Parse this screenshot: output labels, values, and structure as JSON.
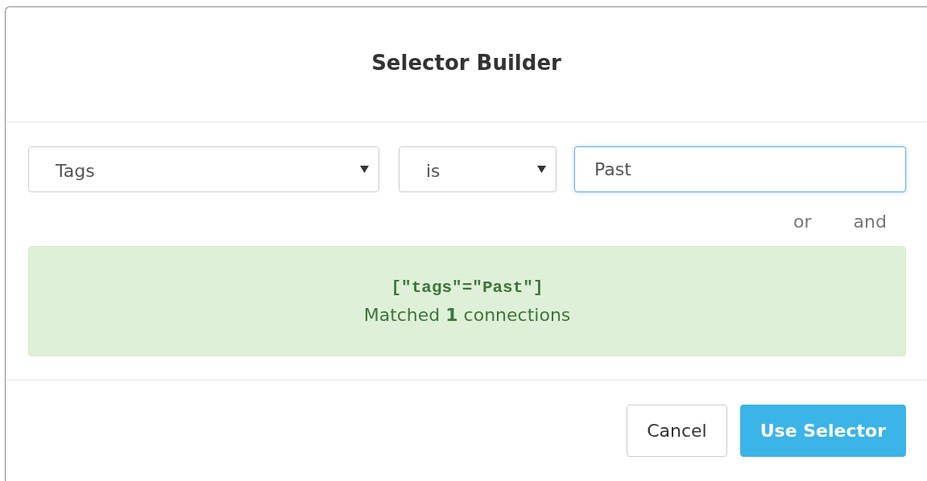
{
  "dialog": {
    "title": "Selector Builder",
    "selects": [
      {
        "value": "Tags"
      },
      {
        "value": "is"
      }
    ],
    "value_field": {
      "value": "Past",
      "focused": true
    },
    "combinators": [
      "or",
      "and"
    ],
    "result": {
      "expression": "[\"tags\"=\"Past\"]",
      "summary": "Matched **1** connections"
    },
    "buttons": [
      {
        "label": "Cancel",
        "kind": "default"
      },
      {
        "label": "Use Selector",
        "kind": "primary"
      }
    ]
  }
}
